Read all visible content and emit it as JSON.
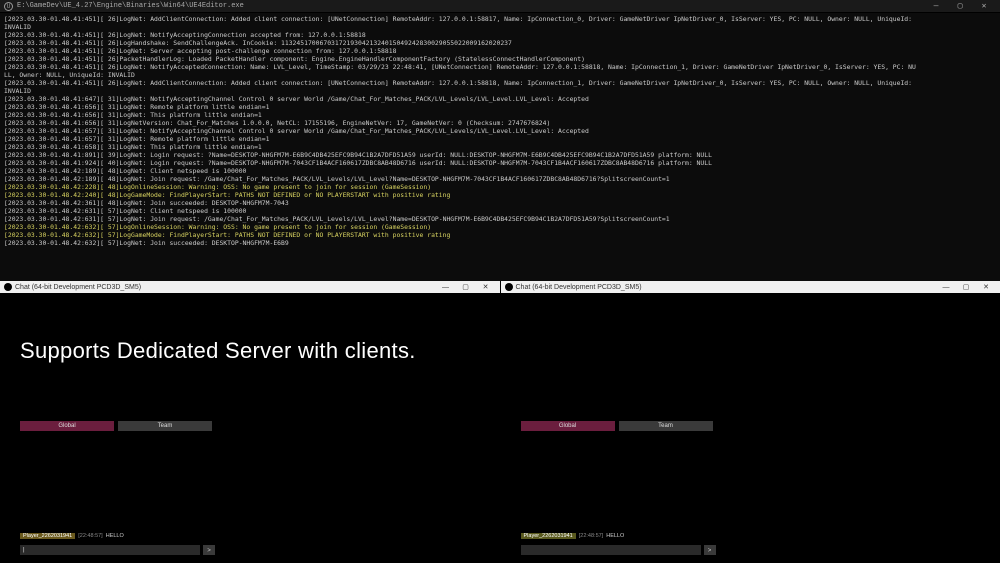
{
  "topbar": {
    "title": "E:\\GameDev\\UE_4.27\\Engine\\Binaries\\Win64\\UE4Editor.exe"
  },
  "overlay": {
    "text": "Supports Dedicated Server with clients."
  },
  "client": {
    "title": "Chat (64-bit Development PCD3D_SM5)"
  },
  "tabs": {
    "global": "Global",
    "team": "Team"
  },
  "chat": {
    "player_a": "Player_2262031941",
    "player_b": "Player_2262031941",
    "time": "[22:48:57]",
    "msg": "HELLO",
    "send": ">"
  },
  "log": [
    {
      "w": 0,
      "t": "[2023.03.30-01.48.41:451][ 26]LogNet: AddClientConnection: Added client connection: [UNetConnection] RemoteAddr: 127.0.0.1:58817, Name: IpConnection_0, Driver: GameNetDriver IpNetDriver_0, IsServer: YES, PC: NULL, Owner: NULL, UniqueId:"
    },
    {
      "w": 0,
      "t": "INVALID"
    },
    {
      "w": 0,
      "t": "[2023.03.30-01.48.41:451][ 26]LogNet: NotifyAcceptingConnection accepted from: 127.0.0.1:58818"
    },
    {
      "w": 0,
      "t": "[2023.03.30-01.48.41:451][ 26]LogHandshake: SendChallengeAck. InCookie: 113245170067031721930421324015049242830029055022009162020237"
    },
    {
      "w": 0,
      "t": "[2023.03.30-01.48.41:451][ 26]LogNet: Server accepting post-challenge connection from: 127.0.0.1:58818"
    },
    {
      "w": 0,
      "t": "[2023.03.30-01.48.41:451][ 26]PacketHandlerLog: Loaded PacketHandler component: Engine.EngineHandlerComponentFactory (StatelessConnectHandlerComponent)"
    },
    {
      "w": 0,
      "t": "[2023.03.30-01.48.41:451][ 26]LogNet: NotifyAcceptedConnection: Name: LVL_Level, TimeStamp: 03/29/23 22:48:41, [UNetConnection] RemoteAddr: 127.0.0.1:58818, Name: IpConnection_1, Driver: GameNetDriver IpNetDriver_0, IsServer: YES, PC: NU"
    },
    {
      "w": 0,
      "t": "LL, Owner: NULL, UniqueId: INVALID"
    },
    {
      "w": 0,
      "t": "[2023.03.30-01.48.41:451][ 26]LogNet: AddClientConnection: Added client connection: [UNetConnection] RemoteAddr: 127.0.0.1:58818, Name: IpConnection_1, Driver: GameNetDriver IpNetDriver_0, IsServer: YES, PC: NULL, Owner: NULL, UniqueId:"
    },
    {
      "w": 0,
      "t": "INVALID"
    },
    {
      "w": 0,
      "t": "[2023.03.30-01.48.41:647][ 31]LogNet: NotifyAcceptingChannel Control 0 server World /Game/Chat_For_Matches_PACK/LVL_Levels/LVL_Level.LVL_Level: Accepted"
    },
    {
      "w": 0,
      "t": "[2023.03.30-01.48.41:656][ 31]LogNet: Remote platform little endian=1"
    },
    {
      "w": 0,
      "t": "[2023.03.30-01.48.41:656][ 31]LogNet: This platform little endian=1"
    },
    {
      "w": 0,
      "t": "[2023.03.30-01.48.41:656][ 31]LogNetVersion: Chat_For_Matches 1.0.0.0, NetCL: 17155196, EngineNetVer: 17, GameNetVer: 0 (Checksum: 2747676824)"
    },
    {
      "w": 0,
      "t": "[2023.03.30-01.48.41:657][ 31]LogNet: NotifyAcceptingChannel Control 0 server World /Game/Chat_For_Matches_PACK/LVL_Levels/LVL_Level.LVL_Level: Accepted"
    },
    {
      "w": 0,
      "t": "[2023.03.30-01.48.41:657][ 31]LogNet: Remote platform little endian=1"
    },
    {
      "w": 0,
      "t": "[2023.03.30-01.48.41:658][ 31]LogNet: This platform little endian=1"
    },
    {
      "w": 0,
      "t": "[2023.03.30-01.48.41:891][ 39]LogNet: Login request: ?Name=DESKTOP-NHGFM7M-E6B9C4DB425EFC9B94C1B2A7DFD51A59 userId: NULL:DESKTOP-NHGFM7M-E6B9C4DB425EFC9B94C1B2A7DFD51A59 platform: NULL"
    },
    {
      "w": 0,
      "t": "[2023.03.30-01.48.41:924][ 40]LogNet: Login request: ?Name=DESKTOP-NHGFM7M-7043CF1B4ACF160617ZDBC8AB48D6716 userId: NULL:DESKTOP-NHGFM7M-7043CF1B4ACF160617ZDBC8AB48D6716 platform: NULL"
    },
    {
      "w": 0,
      "t": "[2023.03.30-01.48.42:189][ 48]LogNet: Client netspeed is 100000"
    },
    {
      "w": 0,
      "t": "[2023.03.30-01.48.42:189][ 48]LogNet: Join request: /Game/Chat_For_Matches_PACK/LVL_Levels/LVL_Level?Name=DESKTOP-NHGFM7M-7043CF1B4ACF160617ZDBC8AB48D6716?SplitscreenCount=1"
    },
    {
      "w": 1,
      "t": "[2023.03.30-01.48.42:228][ 48]LogOnlineSession: Warning: OSS: No game present to join for session (GameSession)"
    },
    {
      "w": 1,
      "t": "[2023.03.30-01.48.42:240][ 48]LogGameMode: FindPlayerStart: PATHS NOT DEFINED or NO PLAYERSTART with positive rating"
    },
    {
      "w": 0,
      "t": "[2023.03.30-01.48.42:361][ 48]LogNet: Join succeeded: DESKTOP-NHGFM7M-7043"
    },
    {
      "w": 0,
      "t": "[2023.03.30-01.48.42:631][ 57]LogNet: Client netspeed is 100000"
    },
    {
      "w": 0,
      "t": "[2023.03.30-01.48.42:631][ 57]LogNet: Join request: /Game/Chat_For_Matches_PACK/LVL_Levels/LVL_Level?Name=DESKTOP-NHGFM7M-E6B9C4DB425EFC9B94C1B2A7DFD51A59?SplitscreenCount=1"
    },
    {
      "w": 1,
      "t": "[2023.03.30-01.48.42:632][ 57]LogOnlineSession: Warning: OSS: No game present to join for session (GameSession)"
    },
    {
      "w": 1,
      "t": "[2023.03.30-01.48.42:632][ 57]LogGameMode: FindPlayerStart: PATHS NOT DEFINED or NO PLAYERSTART with positive rating"
    },
    {
      "w": 0,
      "t": "[2023.03.30-01.48.42:632][ 57]LogNet: Join succeeded: DESKTOP-NHGFM7M-E6B9"
    }
  ]
}
